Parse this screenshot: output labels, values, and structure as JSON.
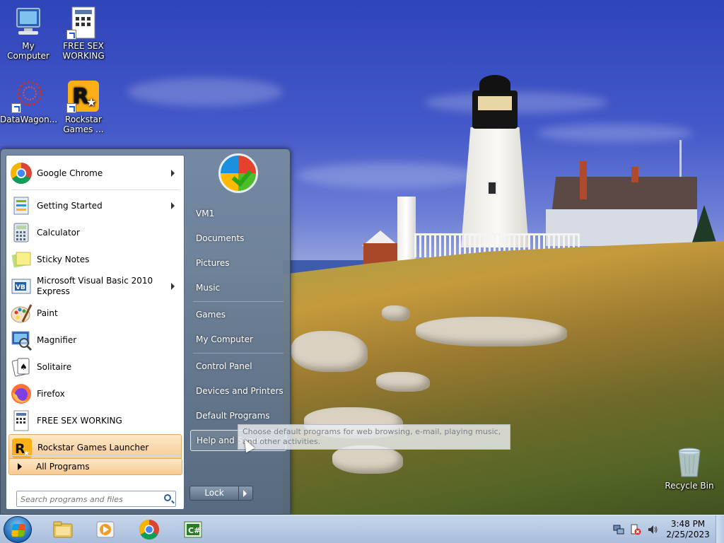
{
  "desktop": {
    "icons": [
      {
        "label": "My Computer",
        "icon": "computer-icon"
      },
      {
        "label": "FREE SEX WORKING",
        "icon": "document-icon"
      },
      {
        "label": "DataWagon...",
        "icon": "datawagon-icon"
      },
      {
        "label": "Rockstar Games ...",
        "icon": "rockstar-icon"
      },
      {
        "label": "Recycle Bin",
        "icon": "recycle-bin-icon"
      }
    ]
  },
  "start_menu": {
    "programs": [
      {
        "label": "Google Chrome",
        "icon": "chrome-icon",
        "has_submenu": true
      },
      {
        "label": "Getting Started",
        "icon": "getting-started-icon",
        "has_submenu": true
      },
      {
        "label": "Calculator",
        "icon": "calculator-icon",
        "has_submenu": false
      },
      {
        "label": "Sticky Notes",
        "icon": "sticky-notes-icon",
        "has_submenu": false
      },
      {
        "label": "Microsoft Visual Basic 2010 Express",
        "line1": "Microsoft Visual Basic 2010",
        "line2": "Express",
        "icon": "visual-basic-icon",
        "has_submenu": true
      },
      {
        "label": "Paint",
        "icon": "paint-icon",
        "has_submenu": false
      },
      {
        "label": "Magnifier",
        "icon": "magnifier-icon",
        "has_submenu": false
      },
      {
        "label": "Solitaire",
        "icon": "solitaire-icon",
        "has_submenu": false
      },
      {
        "label": "Firefox",
        "icon": "firefox-icon",
        "has_submenu": false
      },
      {
        "label": "FREE SEX WORKING",
        "icon": "document-icon",
        "has_submenu": false
      },
      {
        "label": "Rockstar Games Launcher",
        "icon": "rockstar-icon",
        "has_submenu": false,
        "highlighted": true
      }
    ],
    "all_programs": "All Programs",
    "search_placeholder": "Search programs and files",
    "right_items": [
      {
        "label": "VM1"
      },
      {
        "label": "Documents"
      },
      {
        "label": "Pictures"
      },
      {
        "label": "Music"
      },
      {
        "label": "Games"
      },
      {
        "label": "My Computer"
      },
      {
        "label": "Control Panel"
      },
      {
        "label": "Devices and Printers"
      },
      {
        "label": "Default Programs"
      },
      {
        "label": "Help and Support",
        "active": true
      }
    ],
    "lock_label": "Lock",
    "tooltip": "Choose default programs for web browsing, e-mail, playing music, and other activities."
  },
  "taskbar": {
    "pinned": [
      {
        "name": "windows-explorer",
        "icon": "folder-icon"
      },
      {
        "name": "media-player",
        "icon": "media-player-icon"
      },
      {
        "name": "google-chrome",
        "icon": "chrome-icon"
      },
      {
        "name": "visual-csharp",
        "icon": "csharp-icon"
      }
    ],
    "clock_time": "3:48 PM",
    "clock_date": "2/25/2023"
  },
  "colors": {
    "menu_highlight": "#f6c991",
    "taskbar": "#b9cbe4",
    "sky": "#3d52c2"
  }
}
